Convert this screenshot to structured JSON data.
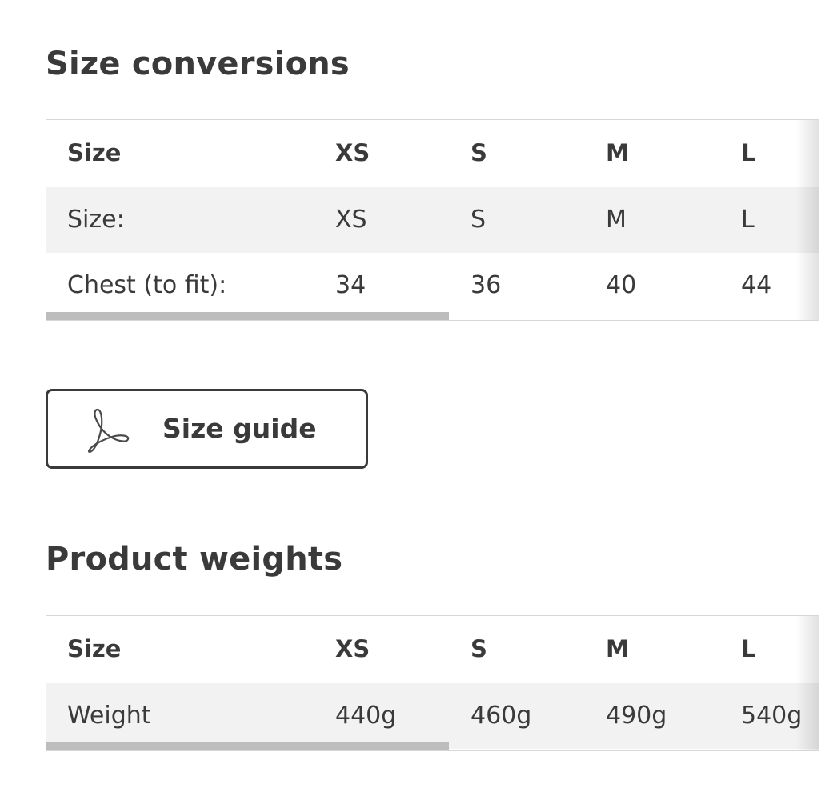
{
  "size_conversions": {
    "title": "Size conversions",
    "header": [
      "Size",
      "XS",
      "S",
      "M",
      "L"
    ],
    "rows": [
      [
        "Size:",
        "XS",
        "S",
        "M",
        "L"
      ],
      [
        "Chest (to fit):",
        "34",
        "36",
        "40",
        "44"
      ]
    ]
  },
  "size_guide": {
    "label": "Size guide",
    "icon": "pdf-icon"
  },
  "product_weights": {
    "title": "Product weights",
    "header": [
      "Size",
      "XS",
      "S",
      "M",
      "L"
    ],
    "rows": [
      [
        "Weight",
        "440g",
        "460g",
        "490g",
        "540g"
      ]
    ]
  }
}
